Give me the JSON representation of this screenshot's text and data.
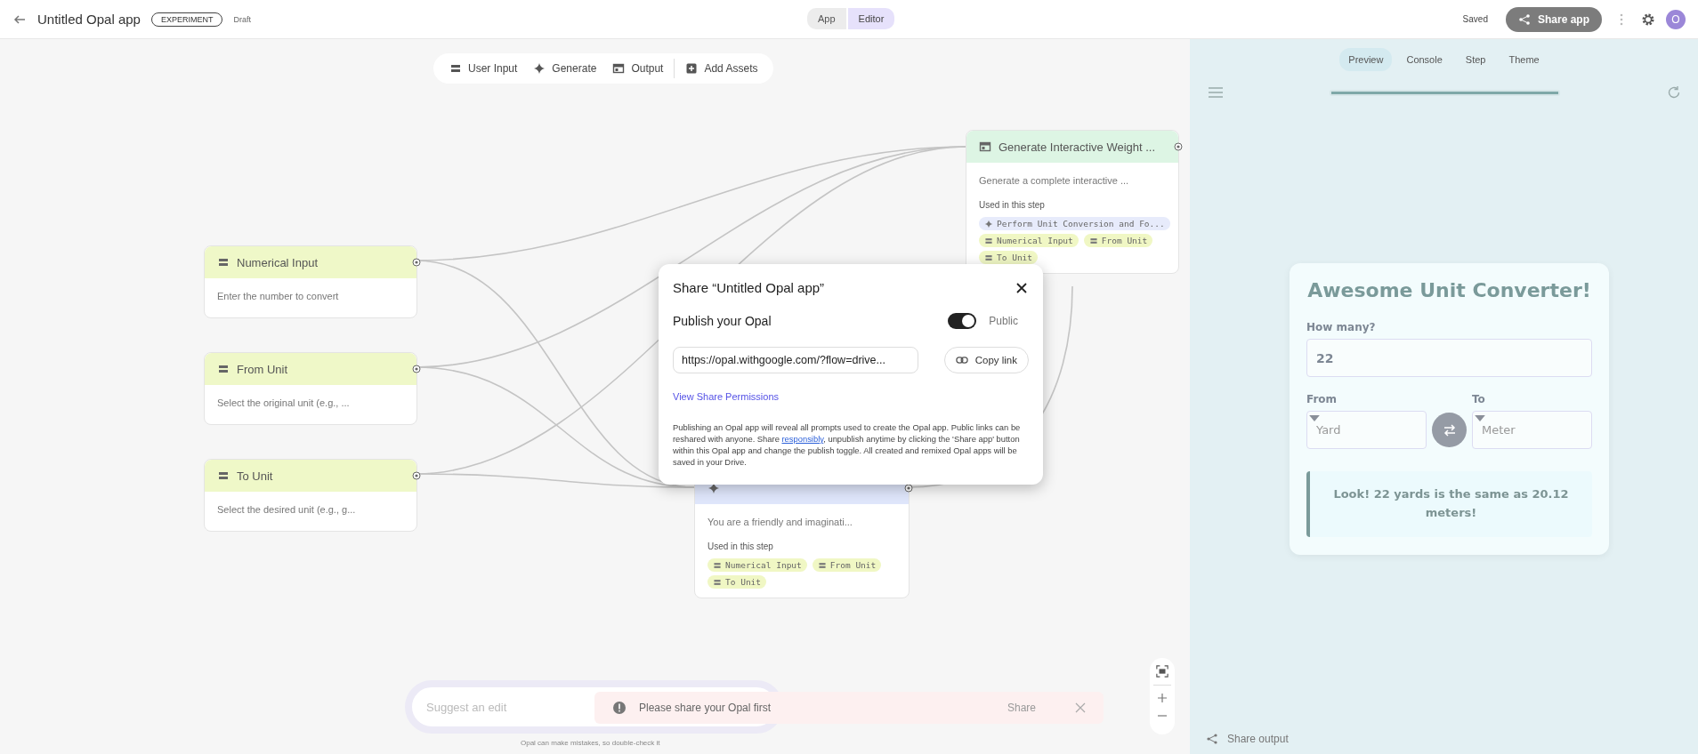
{
  "header": {
    "title": "Untitled Opal app",
    "badge": "EXPERIMENT",
    "status": "Draft",
    "saved": "Saved",
    "share_button": "Share app",
    "avatar": "O"
  },
  "mode_switch": [
    {
      "label": "App",
      "selected": false
    },
    {
      "label": "Editor",
      "selected": true
    }
  ],
  "canvas_toolbar": [
    {
      "kind": "input",
      "label": "User Input"
    },
    {
      "kind": "generate",
      "label": "Generate"
    },
    {
      "kind": "output",
      "label": "Output"
    },
    {
      "kind": "assets",
      "label": "Add Assets"
    }
  ],
  "nodes": [
    {
      "kind": "input",
      "title": "Numerical Input",
      "description": "Enter the number to convert"
    },
    {
      "kind": "input",
      "title": "From Unit",
      "description": "Select the original unit (e.g., ..."
    },
    {
      "kind": "input",
      "title": "To Unit",
      "description": "Select the desired unit (e.g., g..."
    },
    {
      "kind": "output",
      "title": "Generate Interactive Weight ...",
      "description": "Generate a complete interactive ...",
      "used_label": "Used in this step",
      "chips": [
        {
          "kind": "generate",
          "label": "Perform Unit Conversion and Fo..."
        },
        {
          "kind": "input",
          "label": "Numerical Input"
        },
        {
          "kind": "input",
          "label": "From Unit"
        },
        {
          "kind": "input",
          "label": "To Unit"
        }
      ]
    },
    {
      "kind": "generate",
      "description": "You are a friendly and imaginati...",
      "used_label": "Used in this step",
      "chips": [
        {
          "kind": "input",
          "label": "Numerical Input"
        },
        {
          "kind": "input",
          "label": "From Unit"
        },
        {
          "kind": "input",
          "label": "To Unit"
        }
      ]
    }
  ],
  "share_dialog": {
    "title": "Share “Untitled Opal app”",
    "publish_label": "Publish your Opal",
    "publish_on": true,
    "toggle_label": "Public",
    "url": "https://opal.withgoogle.com/?flow=drive...",
    "copy_button": "Copy link",
    "permissions_link": "View Share Permissions",
    "notice_before": "Publishing an Opal app will reveal all prompts used to create the Opal app. Public links can be reshared with anyone. Share ",
    "notice_link": "responsibly",
    "notice_after": ", unpublish anytime by clicking the 'Share app' button within this Opal app and change the publish toggle. All created and remixed Opal apps will be saved in your Drive."
  },
  "suggest_field": {
    "placeholder": "Suggest an edit"
  },
  "disclaimer": "Opal can make mistakes, so double-check it",
  "toast": {
    "message": "Please share your Opal first",
    "action": "Share"
  },
  "preview": {
    "tabs": [
      {
        "label": "Preview",
        "selected": true
      },
      {
        "label": "Console",
        "selected": false
      },
      {
        "label": "Step",
        "selected": false
      },
      {
        "label": "Theme",
        "selected": false
      }
    ],
    "progress": {
      "level": 1
    },
    "card": {
      "title": "Awesome Unit Converter!",
      "amount_label": "How many?",
      "amount_value": "22",
      "from_label": "From",
      "from_value": "Yard",
      "to_label": "To",
      "to_value": "Meter",
      "result": "Look! 22 yards is the same as 20.12 meters!"
    },
    "share_output": "Share output"
  }
}
